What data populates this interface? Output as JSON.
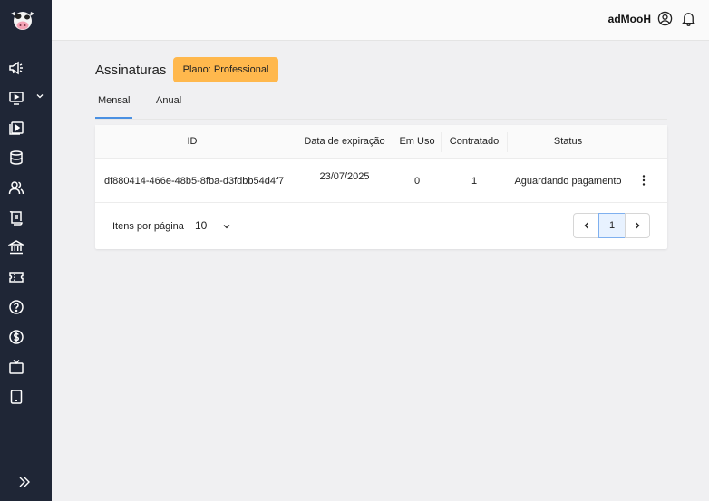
{
  "topbar": {
    "user_name": "adMooH"
  },
  "page": {
    "title": "Assinaturas",
    "plan_badge": "Plano: Professional"
  },
  "tabs": [
    {
      "label": "Mensal",
      "active": true
    },
    {
      "label": "Anual",
      "active": false
    }
  ],
  "table": {
    "columns": [
      "ID",
      "Data de expiração",
      "Em Uso",
      "Contratado",
      "Status"
    ],
    "rows": [
      {
        "id": "df880414-466e-48b5-8fba-d3fdbb54d4f7",
        "expiration": "23/07/2025",
        "in_use": "0",
        "contracted": "1",
        "status": "Aguardando pagamento"
      }
    ]
  },
  "pagination": {
    "label": "Itens por página",
    "page_size": "10",
    "current_page": "1"
  },
  "sidebar": {
    "icons": [
      "megaphone-icon",
      "monitor-play-icon",
      "playlist-icon",
      "database-icon",
      "users-icon",
      "scroll-icon",
      "bank-icon",
      "ticket-icon",
      "help-icon",
      "dollar-icon",
      "tv-icon",
      "tablet-icon"
    ]
  },
  "colors": {
    "sidebar": "#1f2636",
    "accent": "#4a90e2",
    "badge": "#ffb84d"
  }
}
